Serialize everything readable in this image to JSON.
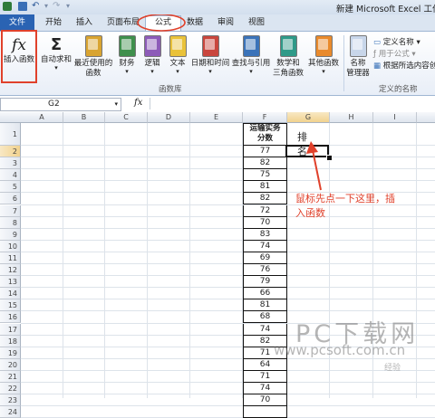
{
  "window": {
    "title": "新建 Microsoft Excel 工作表"
  },
  "tabs": [
    "文件",
    "开始",
    "插入",
    "页面布局",
    "公式",
    "数据",
    "审阅",
    "视图"
  ],
  "ribbon": {
    "insert_function": "插入函数",
    "autosum": "自动求和",
    "recent_1": "最近使用的",
    "recent_2": "函数",
    "financial": "财务",
    "logical": "逻辑",
    "text": "文本",
    "datetime": "日期和时间",
    "lookup": "查找与引用",
    "math_1": "数学和",
    "math_2": "三角函数",
    "other": "其他函数",
    "name_mgr_1": "名称",
    "name_mgr_2": "管理器",
    "define_name": "定义名称",
    "use_in_formula": "用于公式",
    "create_from_sel": "根据所选内容创",
    "group_library": "函数库",
    "group_names": "定义的名称"
  },
  "formula_bar": {
    "name_box": "G2",
    "fx": "fx",
    "value": ""
  },
  "columns": [
    "A",
    "B",
    "C",
    "D",
    "E",
    "F",
    "G",
    "H",
    "I"
  ],
  "rows": [
    "1",
    "2",
    "3",
    "4",
    "5",
    "6",
    "7",
    "8",
    "9",
    "10",
    "11",
    "12",
    "13",
    "14",
    "15",
    "16",
    "17",
    "18",
    "19",
    "20",
    "21",
    "22",
    "23",
    "24"
  ],
  "sheet": {
    "f_header_1": "运输实务",
    "f_header_2": "分数",
    "g_header": "排名",
    "scores": [
      "77",
      "82",
      "75",
      "81",
      "82",
      "72",
      "70",
      "83",
      "74",
      "69",
      "76",
      "79",
      "66",
      "81",
      "68",
      "74",
      "82",
      "71",
      "64",
      "71",
      "74",
      "70",
      ""
    ]
  },
  "annotation": {
    "line1": "鼠标先点一下这里，插",
    "line2": "入函数"
  },
  "watermark": {
    "brand": "PC下载网",
    "url": "www.pcsoft.com.cn",
    "small": "经验"
  },
  "colors": {
    "file_tab": "#2a63b3",
    "highlight_red": "#e0412b",
    "ribbon_border": "#9fb6d3"
  }
}
